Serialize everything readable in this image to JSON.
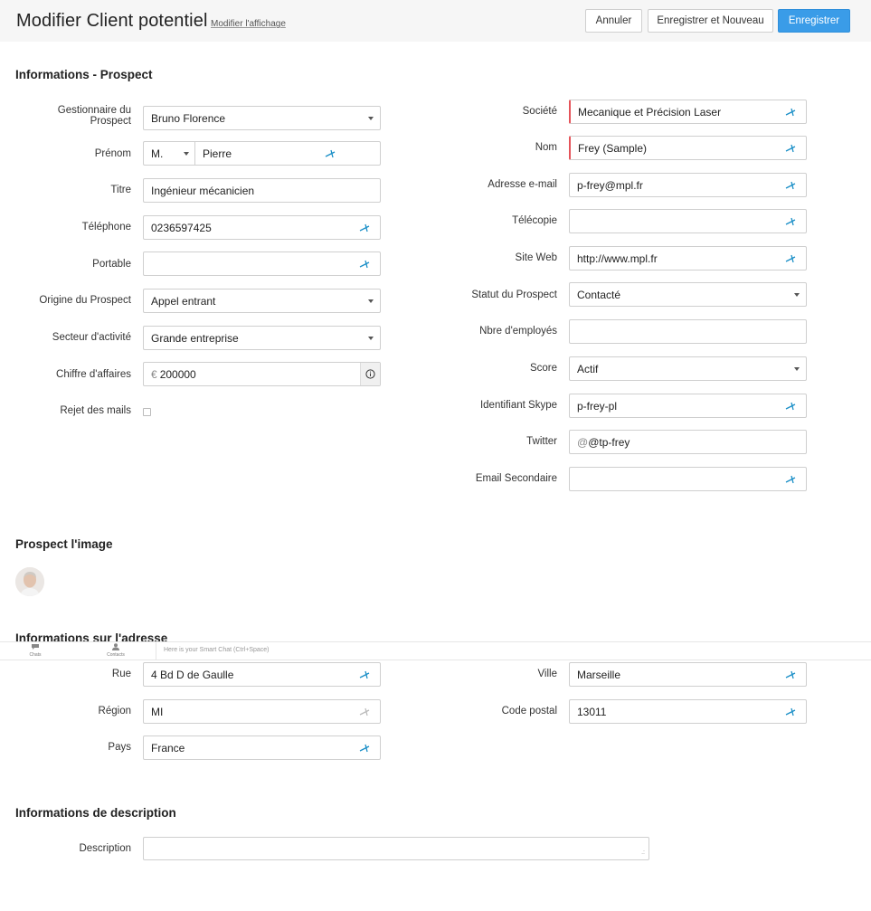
{
  "header": {
    "title": "Modifier Client potentiel",
    "layout_link": "Modifier l'affichage",
    "cancel_label": "Annuler",
    "save_new_label": "Enregistrer et Nouveau",
    "save_label": "Enregistrer"
  },
  "sections": {
    "prospect_info": "Informations - Prospect",
    "prospect_image": "Prospect l'image",
    "address_info": "Informations sur l'adresse",
    "description_info": "Informations de description"
  },
  "left_fields": {
    "owner": {
      "label": "Gestionnaire du Prospect",
      "value": "Bruno Florence"
    },
    "first_name": {
      "label": "Prénom",
      "salutation": "M.",
      "value": "Pierre"
    },
    "title": {
      "label": "Titre",
      "value": "Ingénieur mécanicien"
    },
    "phone": {
      "label": "Téléphone",
      "value": "0236597425"
    },
    "mobile": {
      "label": "Portable",
      "value": ""
    },
    "lead_source": {
      "label": "Origine du Prospect",
      "value": "Appel entrant"
    },
    "industry": {
      "label": "Secteur d'activité",
      "value": "Grande entreprise"
    },
    "revenue": {
      "label": "Chiffre d'affaires",
      "prefix": "€",
      "value": "200000"
    },
    "email_opt_out": {
      "label": "Rejet des mails",
      "checked": false
    }
  },
  "right_fields": {
    "company": {
      "label": "Société",
      "value": "Mecanique et Précision Laser"
    },
    "last_name": {
      "label": "Nom",
      "value": "Frey (Sample)"
    },
    "email": {
      "label": "Adresse e-mail",
      "value": "p-frey@mpl.fr"
    },
    "fax": {
      "label": "Télécopie",
      "value": ""
    },
    "website": {
      "label": "Site Web",
      "value": "http://www.mpl.fr"
    },
    "status": {
      "label": "Statut du Prospect",
      "value": "Contacté"
    },
    "employees": {
      "label": "Nbre d'employés",
      "value": ""
    },
    "rating": {
      "label": "Score",
      "value": "Actif"
    },
    "skype": {
      "label": "Identifiant Skype",
      "value": "p-frey-pl"
    },
    "twitter": {
      "label": "Twitter",
      "prefix": "@",
      "value": "@tp-frey"
    },
    "secondary_email": {
      "label": "Email Secondaire",
      "value": ""
    }
  },
  "chatbar": {
    "chats_label": "Chats",
    "contacts_label": "Contacts",
    "placeholder": "Here is your Smart Chat (Ctrl+Space)"
  },
  "address": {
    "street": {
      "label": "Rue",
      "value": "4 Bd D de Gaulle"
    },
    "state": {
      "label": "Région",
      "value": "MI"
    },
    "country": {
      "label": "Pays",
      "value": "France"
    },
    "city": {
      "label": "Ville",
      "value": "Marseille"
    },
    "zip": {
      "label": "Code postal",
      "value": "13011"
    }
  },
  "description": {
    "label": "Description",
    "value": ""
  },
  "colors": {
    "primary": "#3a9ce8",
    "required": "#e5545a",
    "accent_icon": "#1a8fc7"
  }
}
